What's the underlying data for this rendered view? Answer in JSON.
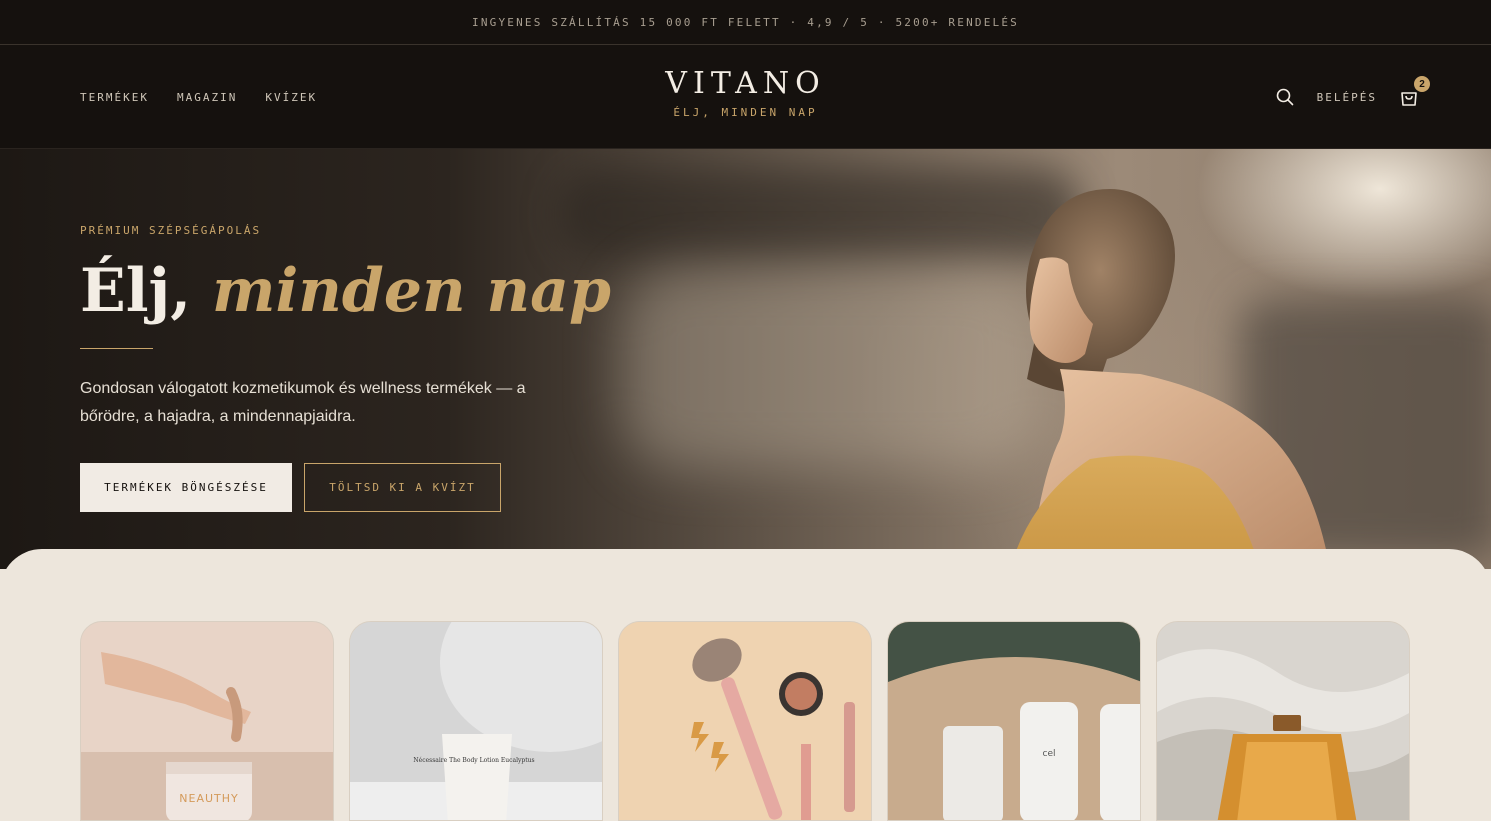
{
  "announcement": "INGYENES SZÁLLÍTÁS 15 000 FT FELETT · 4,9 / 5 · 5200+ RENDELÉS",
  "nav": {
    "items": [
      {
        "label": "TERMÉKEK"
      },
      {
        "label": "MAGAZIN"
      },
      {
        "label": "KVÍZEK"
      }
    ]
  },
  "brand": {
    "logo": "VITANO",
    "tagline": "ÉLJ, MINDEN NAP"
  },
  "tools": {
    "search_icon": "search-icon",
    "login_label": "BELÉPÉS",
    "cart_icon": "shopping-bag-icon",
    "cart_count": "2"
  },
  "hero": {
    "eyebrow": "PRÉMIUM SZÉPSÉGÁPOLÁS",
    "headline_plain": "Élj,",
    "headline_accent": "minden nap",
    "lede": "Gondosan válogatott kozmetikumok és wellness termékek — a bőrödre, a hajadra, a mindennapjaidra.",
    "primary_cta": "TERMÉKEK BÖNGÉSZÉSE",
    "secondary_cta": "TÖLTSD KI A KVÍZT"
  },
  "product_cards": [
    {
      "label_on_product": "NEAUTHY"
    },
    {
      "label_on_product": "Nécessaire The Body Lotion Eucalyptus"
    },
    {
      "label_on_product": ""
    },
    {
      "label_on_product": "cel"
    },
    {
      "label_on_product": ""
    }
  ],
  "colors": {
    "dark": "#15110e",
    "gold": "#c9a56a",
    "cream": "#ede6dc",
    "light_button": "#f1ebe4"
  }
}
